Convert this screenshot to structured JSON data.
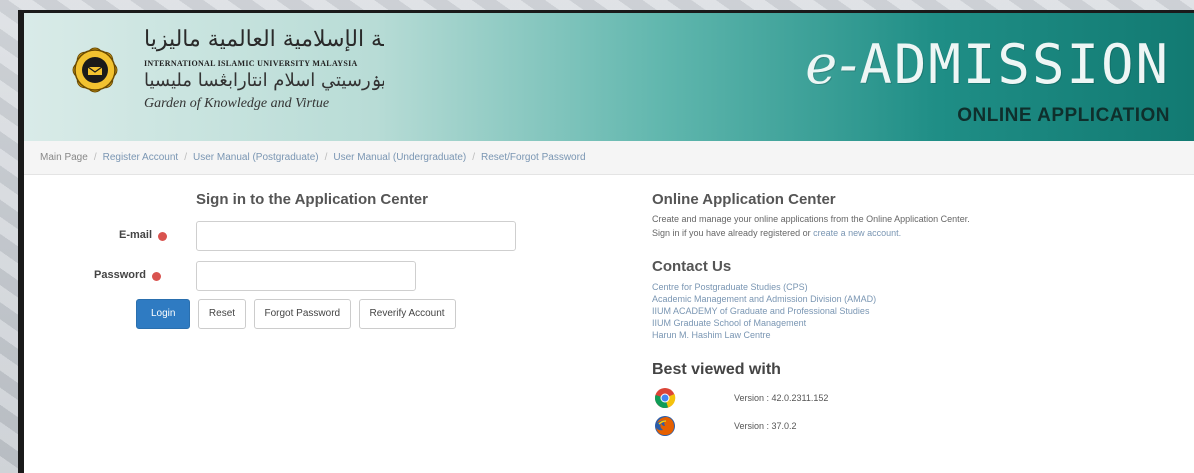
{
  "header": {
    "uni_arabic_name": "الجامعة الإسلامية العالمية ماليزيا",
    "uni_english_name": "INTERNATIONAL ISLAMIC UNIVERSITY MALAYSIA",
    "uni_malay_jawi": "اونيۏرسيتي اسلام انتارابڠسا مليسيا",
    "uni_tagline": "Garden of Knowledge and Virtue",
    "app_title_prefix": "e-",
    "app_title_main": "ADMISSION",
    "app_subtitle": "ONLINE APPLICATION",
    "brand_teal": "#1f8e86"
  },
  "nav": {
    "items": [
      {
        "label": "Main Page"
      },
      {
        "label": "Register Account"
      },
      {
        "label": "User Manual (Postgraduate)"
      },
      {
        "label": "User Manual (Undergraduate)"
      },
      {
        "label": "Reset/Forgot Password"
      }
    ]
  },
  "signin": {
    "heading": "Sign in to the Application Center",
    "email_label": "E-mail",
    "email_value": "",
    "password_label": "Password",
    "password_value": "",
    "buttons": {
      "login": "Login",
      "reset": "Reset",
      "forgot": "Forgot Password",
      "reverify": "Reverify Account"
    }
  },
  "online_center": {
    "title": "Online Application Center",
    "line1": "Create and manage your online applications from the Online Application Center.",
    "line2_prefix": "Sign in if you have already registered or ",
    "line2_link": "create a new account."
  },
  "contact": {
    "title": "Contact Us",
    "links": [
      "Centre for Postgraduate Studies (CPS)",
      "Academic Management and Admission Division (AMAD)",
      "IIUM ACADEMY of Graduate and Professional Studies",
      "IIUM Graduate School of Management",
      "Harun M. Hashim Law Centre"
    ]
  },
  "browsers": {
    "title": "Best viewed with",
    "items": [
      {
        "icon": "chrome-icon",
        "version": "Version : 42.0.2311.152"
      },
      {
        "icon": "firefox-icon",
        "version": "Version : 37.0.2"
      }
    ]
  },
  "colors": {
    "primary_button": "#2f7bc2",
    "required": "#d9534f",
    "link": "#7a96b3"
  }
}
